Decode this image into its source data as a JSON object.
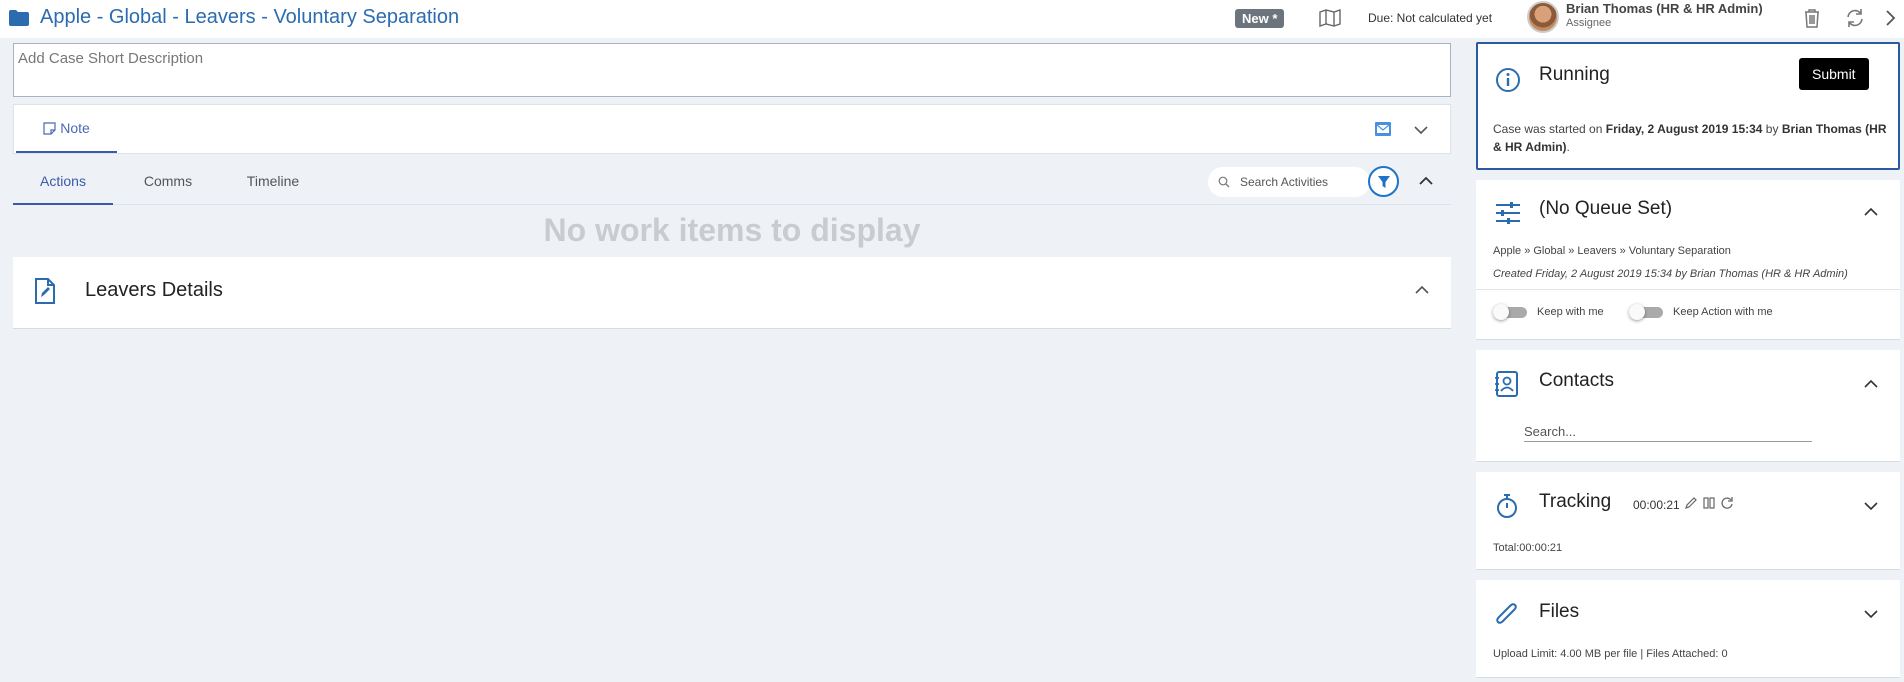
{
  "header": {
    "case_title": "Apple - Global - Leavers - Voluntary Separation",
    "status_badge": "New *",
    "due": "Due: Not calculated yet",
    "assignee_name": "Brian Thomas (HR & HR Admin)",
    "assignee_role": "Assignee",
    "icons": [
      "folder-icon",
      "map-icon",
      "trash-icon",
      "refresh-icon",
      "chevron-right-icon"
    ]
  },
  "main": {
    "short_description_placeholder": "Add Case Short Description",
    "note_tab": "Note",
    "tabs": [
      {
        "label": "Actions",
        "active": true
      },
      {
        "label": "Comms",
        "active": false
      },
      {
        "label": "Timeline",
        "active": false
      }
    ],
    "search_placeholder": "Search Activities",
    "empty_message": "No work items to display",
    "section_title": "Leavers Details"
  },
  "side": {
    "running": {
      "title": "Running",
      "submit_label": "Submit",
      "msg_prefix": "Case was started on ",
      "msg_date": "Friday, 2 August 2019 15:34",
      "msg_by": " by ",
      "msg_user": "Brian Thomas (HR & HR Admin)",
      "msg_suffix": "."
    },
    "queue": {
      "title": "(No Queue Set)",
      "path": "Apple » Global » Leavers » Voluntary Separation",
      "created": "Created Friday, 2 August 2019 15:34 by Brian Thomas (HR & HR Admin)",
      "keep_with_me": "Keep with me",
      "keep_action_with_me": "Keep Action with me"
    },
    "contacts": {
      "title": "Contacts",
      "search_placeholder": "Search..."
    },
    "tracking": {
      "title": "Tracking",
      "timer": "00:00:21",
      "total": "Total:00:00:21"
    },
    "files": {
      "title": "Files",
      "info": "Upload Limit: 4.00 MB per file | Files Attached: 0"
    }
  },
  "colors": {
    "accent": "#2b6cb0",
    "tab_active": "#3b5aa8",
    "badge_bg": "#6c757d",
    "page_bg": "#eef2f6"
  }
}
